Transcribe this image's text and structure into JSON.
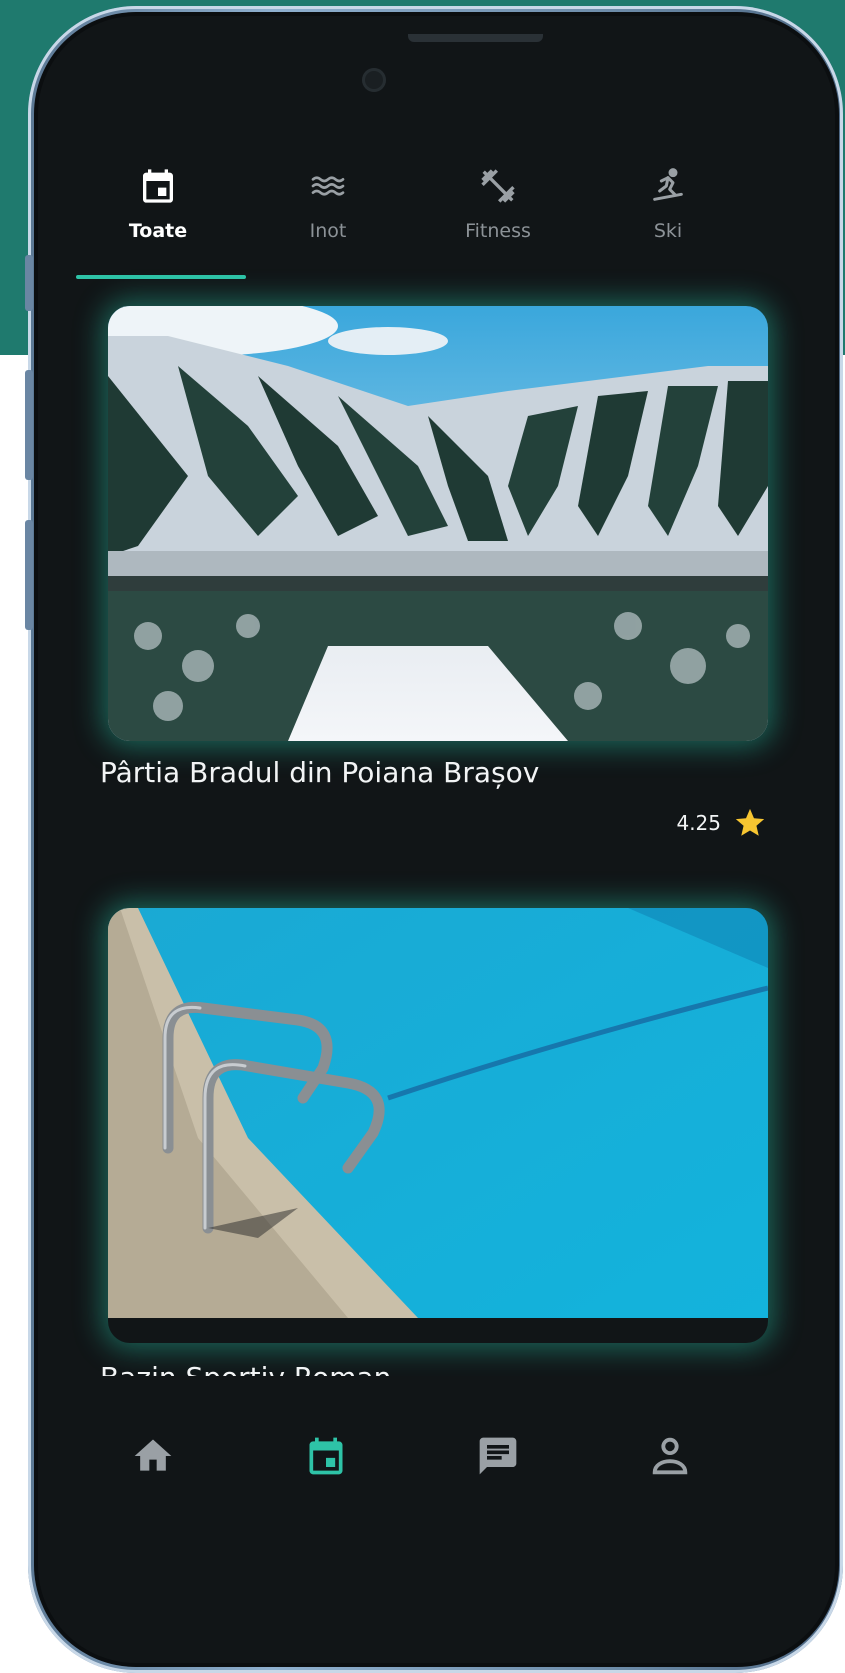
{
  "colors": {
    "accent": "#2ec3a7",
    "background": "#111517",
    "star": "#f7c531"
  },
  "tabs": [
    {
      "label": "Toate",
      "icon": "calendar-icon",
      "active": true
    },
    {
      "label": "Inot",
      "icon": "waves-icon",
      "active": false
    },
    {
      "label": "Fitness",
      "icon": "dumbbell-icon",
      "active": false
    },
    {
      "label": "Ski",
      "icon": "ski-icon",
      "active": false
    }
  ],
  "cards": [
    {
      "title": "Pârtia Bradul din Poiana Brașov",
      "rating": "4.25",
      "image": "ski-slope-photo"
    },
    {
      "title": "Bazin Sportiv Roman",
      "image": "pool-photo"
    }
  ],
  "bottom_nav": [
    {
      "icon": "home-icon",
      "active": false
    },
    {
      "icon": "calendar-icon",
      "active": true
    },
    {
      "icon": "chat-icon",
      "active": false
    },
    {
      "icon": "profile-icon",
      "active": false
    }
  ]
}
